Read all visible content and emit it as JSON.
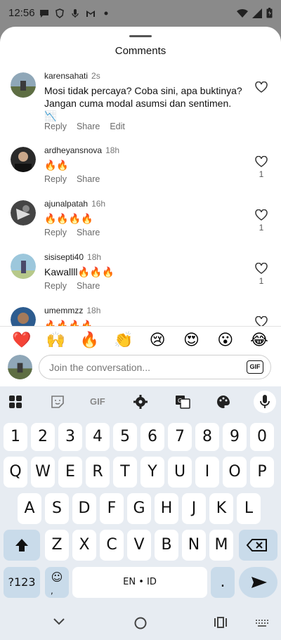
{
  "status_bar": {
    "time": "12:56"
  },
  "sheet": {
    "title": "Comments"
  },
  "comments": [
    {
      "username": "karensahati",
      "time": "2s",
      "text": "Mosi tidak percaya? Coba sini, apa buktinya? Jangan cuma modal asumsi dan sentimen. 📉",
      "actions": [
        "Reply",
        "Share",
        "Edit"
      ],
      "likes": ""
    },
    {
      "username": "ardheyansnova",
      "time": "18h",
      "text": "🔥🔥",
      "actions": [
        "Reply",
        "Share"
      ],
      "likes": "1"
    },
    {
      "username": "ajunalpatah",
      "time": "16h",
      "text": "🔥🔥🔥🔥",
      "actions": [
        "Reply",
        "Share"
      ],
      "likes": "1"
    },
    {
      "username": "sisisepti40",
      "time": "18h",
      "text": "Kawallll🔥🔥🔥",
      "actions": [
        "Reply",
        "Share"
      ],
      "likes": "1"
    },
    {
      "username": "umemmzz",
      "time": "18h",
      "text": "🔥🔥🔥🔥",
      "actions": [],
      "likes": ""
    }
  ],
  "emoji_bar": [
    "❤️",
    "🙌",
    "🔥",
    "👏",
    "😢",
    "😍",
    "😮",
    "😂"
  ],
  "composer": {
    "placeholder": "Join the conversation...",
    "gif_label": "GIF"
  },
  "keyboard": {
    "toolbar_gif_label": "GIF",
    "row_numbers": [
      "1",
      "2",
      "3",
      "4",
      "5",
      "6",
      "7",
      "8",
      "9",
      "0"
    ],
    "row_1": [
      "Q",
      "W",
      "E",
      "R",
      "T",
      "Y",
      "U",
      "I",
      "O",
      "P"
    ],
    "row_2": [
      "A",
      "S",
      "D",
      "F",
      "G",
      "H",
      "J",
      "K",
      "L"
    ],
    "row_3": [
      "Z",
      "X",
      "C",
      "V",
      "B",
      "N",
      "M"
    ],
    "symbols_label": "?123",
    "emoji_key": "☺",
    "space_label": "EN • ID",
    "period_label": "."
  },
  "colors": {
    "accent_key": "#c9dbea",
    "keyboard_bg": "#e7ecf2"
  }
}
